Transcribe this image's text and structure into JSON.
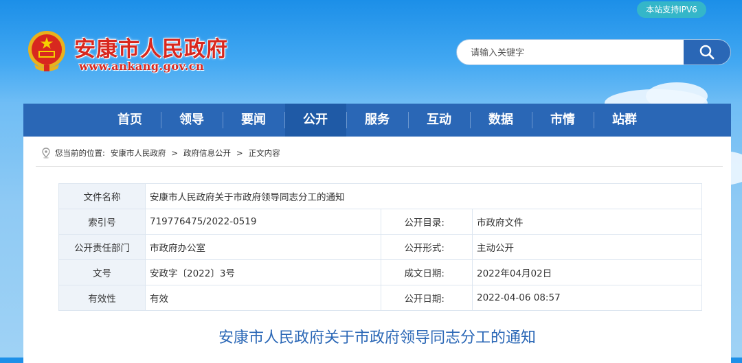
{
  "header": {
    "ipv6_label": "本站支持IPV6",
    "site_title": "安康市人民政府",
    "site_url": "www.ankang.gov.cn",
    "search": {
      "placeholder": "请输入关键字",
      "value": ""
    }
  },
  "nav": {
    "items": [
      "首页",
      "领导",
      "要闻",
      "公开",
      "服务",
      "互动",
      "数据",
      "市情",
      "站群"
    ],
    "active": "公开"
  },
  "breadcrumb": {
    "prefix": "您当前的位置:",
    "items": [
      "安康市人民政府",
      "政府信息公开",
      "正文内容"
    ],
    "separator": ">"
  },
  "meta": {
    "file_name_label": "文件名称",
    "file_name": "安康市人民政府关于市政府领导同志分工的通知",
    "index_label": "索引号",
    "index": "719776475/2022-0519",
    "catalog_label": "公开目录:",
    "catalog": "市政府文件",
    "dept_label": "公开责任部门",
    "dept": "市政府办公室",
    "form_label": "公开形式:",
    "form": "主动公开",
    "docno_label": "文号",
    "docno": "安政字〔2022〕3号",
    "created_label": "成文日期:",
    "created": "2022年04月02日",
    "valid_label": "有效性",
    "valid": "有效",
    "published_label": "公开日期:",
    "published": "2022-04-06 08:57"
  },
  "document": {
    "title": "安康市人民政府关于市政府领导同志分工的通知"
  },
  "colors": {
    "nav_blue": "#2a67b6",
    "title_red": "#d8281f",
    "ipv6_teal": "#34b6c9"
  }
}
